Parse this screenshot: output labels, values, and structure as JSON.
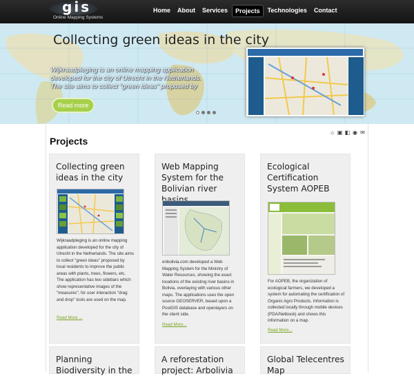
{
  "brand": {
    "logo": "gis",
    "tagline": "Online Mapping Systems"
  },
  "nav": {
    "items": [
      "Home",
      "About",
      "Services",
      "Projects",
      "Technologies",
      "Contact"
    ],
    "active": "Projects"
  },
  "hero": {
    "title": "Collecting green ideas in the city",
    "description": "Wijkraadpleging is an online mapping application developed for the city of Utrecht in the Netherlands. The site aims to collect \"green ideas\" proposed by",
    "button": "Read more",
    "slides": 4,
    "active_slide": 1
  },
  "toolbar": {
    "icons": [
      "home-icon",
      "print-icon",
      "pdf-icon",
      "rss-icon",
      "email-icon"
    ]
  },
  "page": {
    "title": "Projects"
  },
  "projects": [
    {
      "title": "Collecting green ideas in the city",
      "body": "Wijkraadpleging is an online mapping application developed for the city of Utrecht in the Netherlands. The site aims to collect \"green ideas\" proposed by local residents to improve the public areas with plants, trees, flowers, etc. The application has two sidebars which show representative images of the \"measures\"; for user interaction \"drag and drop\" tools are used on the map.",
      "more": "Read More ..."
    },
    {
      "title": "Web Mapping System for the Bolivian river basins",
      "body": "enbolivia.com developed a Web Mapping System for the Ministry of Water Resources, showing the exact locations of the existing river basins in Bolivia, overlaying with various other maps. The applications uses the open source GEOSERVER, based upon a PostGIS database and openlayers on the client side.",
      "more": "Read More..."
    },
    {
      "title": "Ecological Certification System AOPEB",
      "body": "For AOPEB, the organization of ecological farmers, we developed a system for automating the certification of Organic Agro Products. Information is collected locally through mobile devices (PDA/Netbook) and shows this information on a map.",
      "more": "Read More..."
    },
    {
      "title": "Planning Biodiversity in the"
    },
    {
      "title": "A reforestation project: Arbolivia"
    },
    {
      "title": "Global Telecentres Map"
    }
  ]
}
